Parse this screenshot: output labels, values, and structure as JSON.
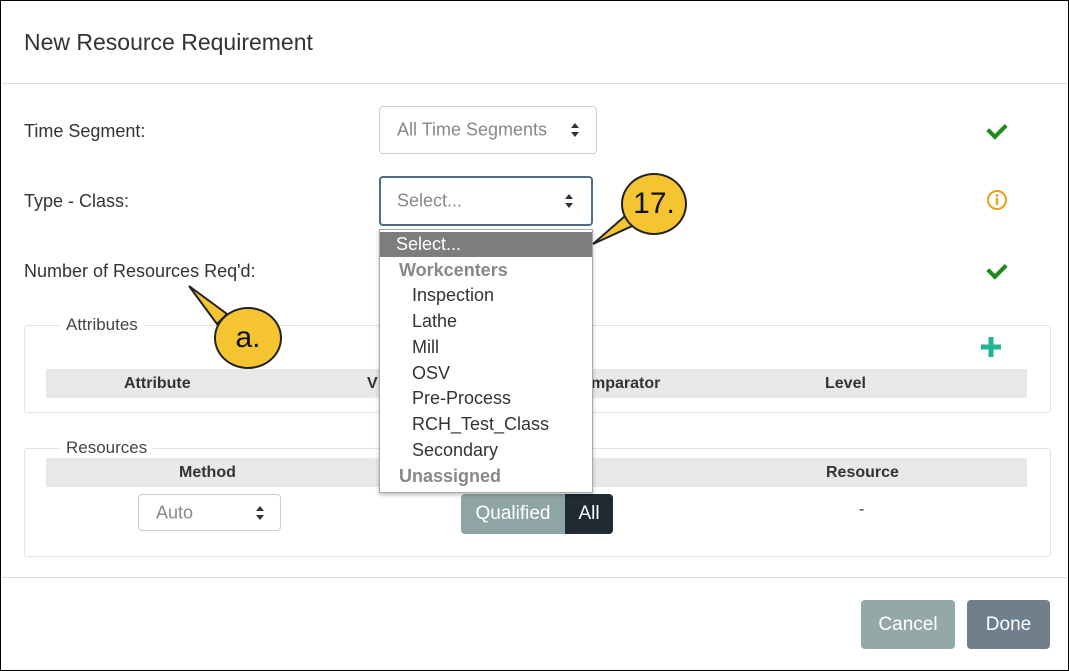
{
  "dialog": {
    "title": "New Resource Requirement"
  },
  "fields": {
    "time_segment": {
      "label": "Time Segment:",
      "value": "All Time Segments"
    },
    "type_class": {
      "label": "Type - Class:",
      "placeholder": "Select..."
    },
    "num_resources": {
      "label": "Number of Resources Req'd:"
    }
  },
  "status_colors": {
    "valid": "#1e8a1e",
    "info": "#e8a317"
  },
  "attributes": {
    "legend": "Attributes",
    "columns": [
      "Attribute",
      "V",
      "mparator",
      "Level"
    ]
  },
  "resources": {
    "legend": "Resources",
    "columns": {
      "method": "Method",
      "resource": "Resource"
    },
    "method_value": "Auto",
    "toggle": {
      "qualified": "Qualified",
      "all": "All"
    },
    "resource_value": "-"
  },
  "dropdown": {
    "selected": "Select...",
    "groups": [
      {
        "label": "Workcenters",
        "items": [
          "Inspection",
          "Lathe",
          "Mill",
          "OSV",
          "Pre-Process",
          "RCH_Test_Class",
          "Secondary"
        ]
      },
      {
        "label": "Unassigned",
        "items": []
      }
    ]
  },
  "footer": {
    "cancel": "Cancel",
    "done": "Done"
  },
  "callouts": {
    "step": "17.",
    "note": "a."
  }
}
